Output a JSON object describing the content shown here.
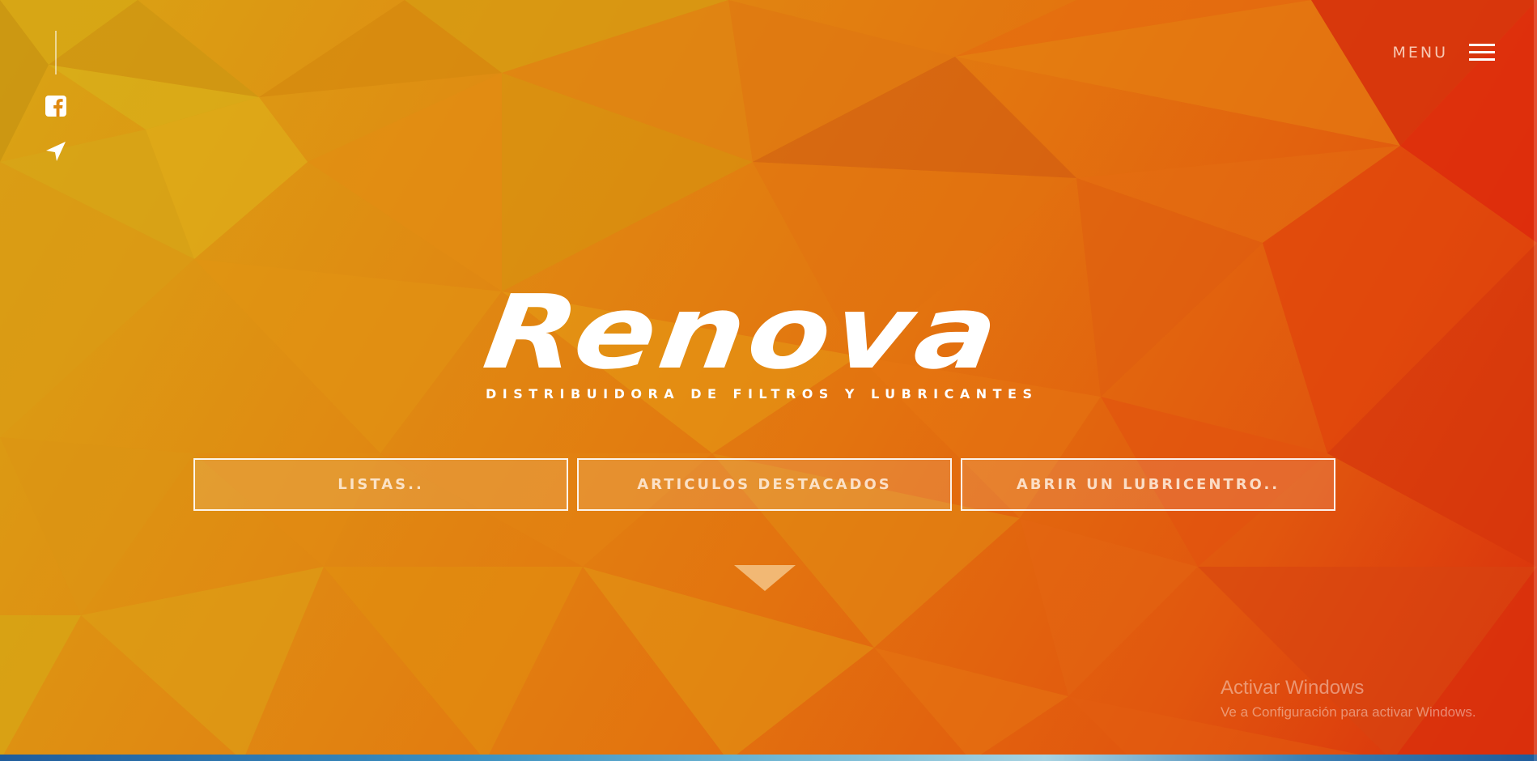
{
  "brand": {
    "logo_text": "Renova",
    "tagline": "DISTRIBUIDORA DE FILTROS Y LUBRICANTES"
  },
  "social": {
    "items": [
      {
        "icon": "facebook-icon"
      },
      {
        "icon": "location-arrow-icon"
      }
    ]
  },
  "header": {
    "menu_label": "MENU",
    "menu_icon": "hamburger-icon"
  },
  "buttons": [
    {
      "label": "LISTAS.."
    },
    {
      "label": "ARTICULOS DESTACADOS"
    },
    {
      "label": "ABRIR UN LUBRICENTRO.."
    }
  ],
  "scroll_hint": {
    "icon": "down-triangle-icon"
  },
  "windows_watermark": {
    "title": "Activar Windows",
    "subtitle": "Ve a Configuración para activar Windows."
  },
  "colors": {
    "accent_yellow": "#d9a514",
    "accent_orange": "#e3740f",
    "accent_red": "#d92b0c",
    "text_white": "#ffffff"
  }
}
